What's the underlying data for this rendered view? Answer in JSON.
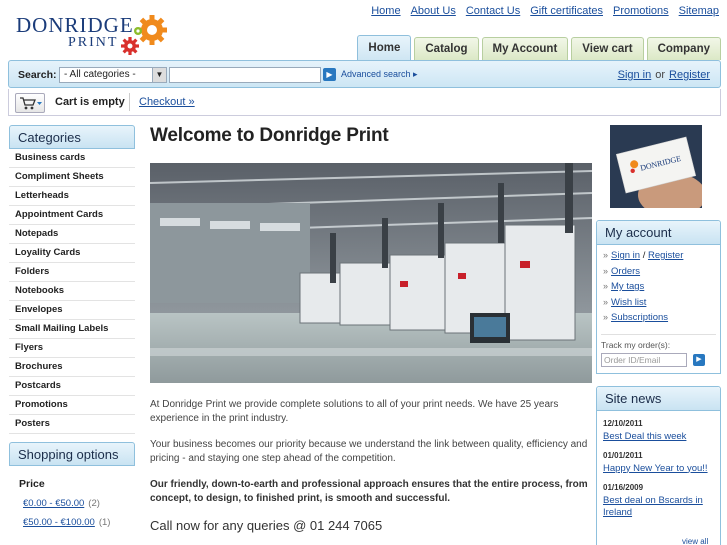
{
  "logo": {
    "line1": "DONRIDGE",
    "line2": "PRINT"
  },
  "top_links": [
    "Home",
    "About Us",
    "Contact Us",
    "Gift certificates",
    "Promotions",
    "Sitemap"
  ],
  "tabs": [
    {
      "label": "Home",
      "active": true
    },
    {
      "label": "Catalog",
      "active": false
    },
    {
      "label": "My Account",
      "active": false
    },
    {
      "label": "View cart",
      "active": false
    },
    {
      "label": "Company",
      "active": false
    }
  ],
  "search": {
    "label": "Search:",
    "category_selected": "- All categories -",
    "advanced_link": "Advanced search ▸"
  },
  "account_links": {
    "sign_in": "Sign in",
    "or": "or",
    "register": "Register"
  },
  "cart": {
    "status": "Cart is empty",
    "checkout": "Checkout »"
  },
  "categories": {
    "title": "Categories",
    "items": [
      "Business cards",
      "Compliment Sheets",
      "Letterheads",
      "Appointment Cards",
      "Notepads",
      "Loyality Cards",
      "Folders",
      "Notebooks",
      "Envelopes",
      "Small Mailing Labels",
      "Flyers",
      "Brochures",
      "Postcards",
      "Promotions",
      "Posters"
    ]
  },
  "shopping_options": {
    "title": "Shopping options",
    "price_title": "Price",
    "ranges": [
      {
        "label": "€0.00 - €50.00",
        "count": "(2)"
      },
      {
        "label": "€50.00 - €100.00",
        "count": "(1)"
      }
    ]
  },
  "main": {
    "title": "Welcome to Donridge Print",
    "paragraphs": [
      "At Donridge Print we provide complete solutions to all of your print needs. We have 25 years experience in the print industry.",
      "Your business becomes our priority because we understand the link between quality, efficiency and pricing - and staying one step ahead of the competition."
    ],
    "bold_paragraph": "Our friendly, down-to-earth and professional approach ensures that the entire process, from concept, to design, to finished print, is smooth and successful.",
    "call": "Call now for any queries @ 01 244 7065"
  },
  "my_account": {
    "title": "My account",
    "sign_in": "Sign in",
    "slash": "/",
    "register": "Register",
    "links": [
      "Orders",
      "My tags",
      "Wish list",
      "Subscriptions"
    ],
    "track_label": "Track my order(s):",
    "track_placeholder": "Order ID/Email"
  },
  "site_news": {
    "title": "Site news",
    "items": [
      {
        "date": "12/10/2011",
        "title": "Best Deal this week"
      },
      {
        "date": "01/01/2011",
        "title": "Happy New Year to you!!"
      },
      {
        "date": "01/16/2009",
        "title": "Best deal on Bscards in Ireland"
      }
    ],
    "view_all": "view all"
  },
  "colors": {
    "link": "#1a4e9c",
    "header_blue": "#cde6f4",
    "tab_green": "#dbe8c6",
    "brand_navy": "#1b3c7a",
    "button_blue": "#2878c0"
  }
}
